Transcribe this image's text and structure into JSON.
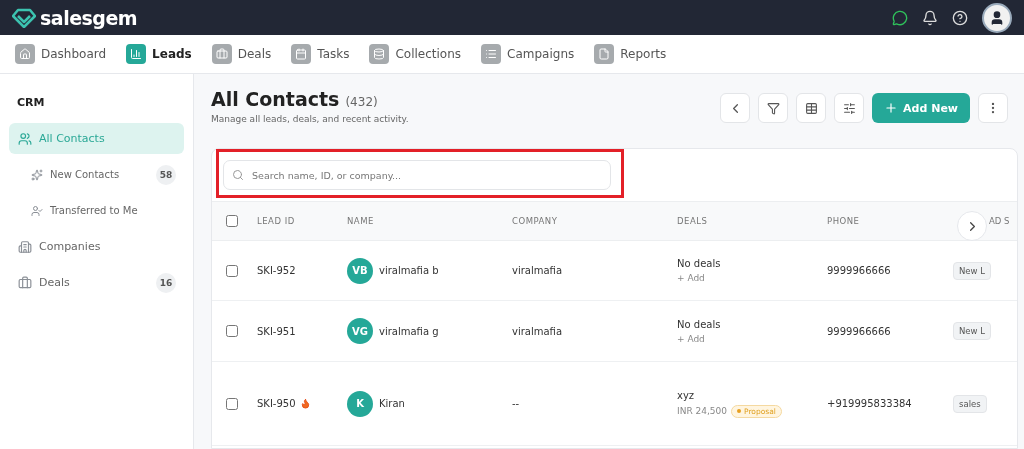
{
  "brand": "salesgem",
  "nav": [
    {
      "label": "Dashboard",
      "selected": false
    },
    {
      "label": "Leads",
      "selected": true
    },
    {
      "label": "Deals",
      "selected": false
    },
    {
      "label": "Tasks",
      "selected": false
    },
    {
      "label": "Collections",
      "selected": false
    },
    {
      "label": "Campaigns",
      "selected": false
    },
    {
      "label": "Reports",
      "selected": false
    }
  ],
  "sidebar": {
    "title": "CRM",
    "items": [
      {
        "label": "All Contacts",
        "selected": true,
        "children": [
          {
            "label": "New Contacts",
            "count": "58",
            "selected": false
          },
          {
            "label": "Transferred to Me",
            "selected": false
          }
        ]
      },
      {
        "label": "Companies",
        "selected": false
      },
      {
        "label": "Deals",
        "count": "16",
        "selected": false
      }
    ]
  },
  "header": {
    "title": "All Contacts",
    "count": "(432)",
    "subtitle": "Manage all leads, deals, and recent activity.",
    "add_button": "Add New"
  },
  "search": {
    "placeholder": "Search name, ID, or company..."
  },
  "table": {
    "all_checked": false,
    "columns": [
      "LEAD ID",
      "NAME",
      "COMPANY",
      "DEALS",
      "PHONE",
      "AD S"
    ],
    "rows": [
      {
        "checked": false,
        "lead_id": "SKI-952",
        "hot": false,
        "initials": "VB",
        "name": "viralmafia b",
        "company": "viralmafia",
        "deal": "No deals",
        "deal_sub": "+ Add",
        "phone": "9999966666",
        "status": "New L"
      },
      {
        "checked": false,
        "lead_id": "SKI-951",
        "hot": false,
        "initials": "VG",
        "name": "viralmafia g",
        "company": "viralmafia",
        "deal": "No deals",
        "deal_sub": "+ Add",
        "phone": "9999966666",
        "status": "New L"
      },
      {
        "checked": false,
        "lead_id": "SKI-950",
        "hot": true,
        "initials": "K",
        "name": "Kiran",
        "company": "--",
        "deal": "xyz",
        "deal_sub": "INR 24,500",
        "stage": "Proposal",
        "phone": "+919995833384",
        "status": "sales"
      }
    ]
  }
}
